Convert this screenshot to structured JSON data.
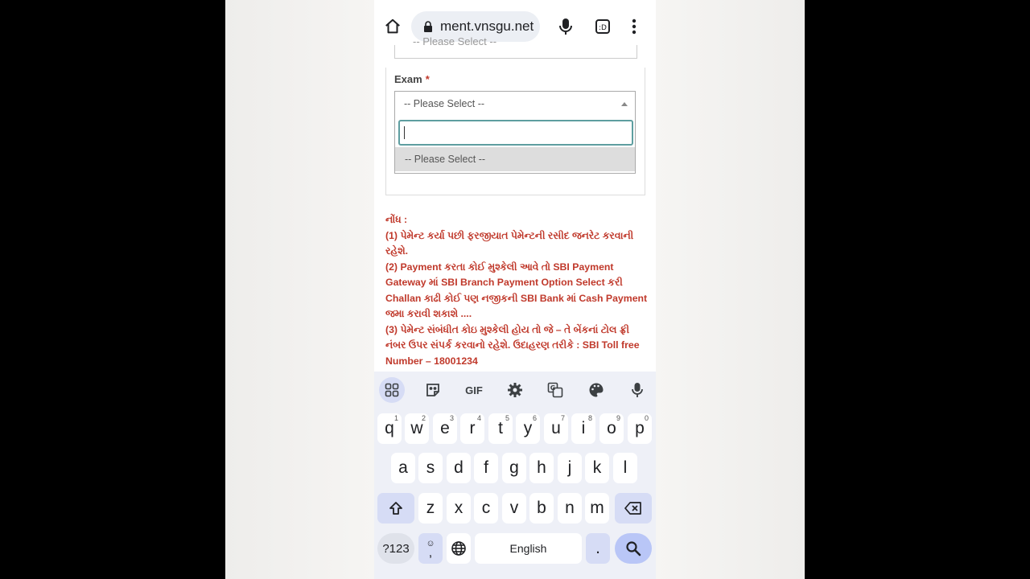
{
  "browser": {
    "url": "ment.vnsgu.net"
  },
  "form": {
    "previous_select_text": "-- Please Select --",
    "exam_label": "Exam",
    "required_mark": "*",
    "exam_select_value": "-- Please Select --",
    "search_value": "",
    "dropdown_options": [
      "-- Please Select --"
    ]
  },
  "note": {
    "heading": "નોંધ :",
    "lines": [
      "(1) પેમેન્ટ કર્યા પછી ફરજીયાત પેમેન્ટની રસીદ જનરેટ કરવાની રહેશે.",
      "(2) Payment કરતા કોઈ મુશ્કેલી આવે તો SBI Payment Gateway માં SBI Branch Payment Option Select કરી Challan કાઢી કોઈ પણ નજીકની SBI Bank માં Cash Payment જમા કરાવી શકાશે ....",
      "(3) પેમેન્ટ સંબંધીત કોઇ મુશ્કેલી હોય તો જે – તે બેંકનાં ટોલ ફ્રી નંબર ઉપર સંપર્ક કરવાનો રહેશે. ઉદાહરણ તરીકે : SBI Toll free Number – 18001234"
    ]
  },
  "keyboard": {
    "toolbar": [
      "apps-icon",
      "sticker-icon",
      "GIF",
      "settings-icon",
      "translate-icon",
      "palette-icon",
      "mic-icon"
    ],
    "gif_label": "GIF",
    "row1": [
      "q",
      "w",
      "e",
      "r",
      "t",
      "y",
      "u",
      "i",
      "o",
      "p"
    ],
    "row1_hints": [
      "1",
      "2",
      "3",
      "4",
      "5",
      "6",
      "7",
      "8",
      "9",
      "0"
    ],
    "row2": [
      "a",
      "s",
      "d",
      "f",
      "g",
      "h",
      "j",
      "k",
      "l"
    ],
    "row3": [
      "z",
      "x",
      "c",
      "v",
      "b",
      "n",
      "m"
    ],
    "symbols_label": "?123",
    "comma": ",",
    "space_label": "English",
    "period": "."
  },
  "colors": {
    "note_red": "#c0392b",
    "focus_teal": "#5e9ea0",
    "keyboard_bg": "#eef0f7",
    "accent_key": "#b9c6f7"
  }
}
